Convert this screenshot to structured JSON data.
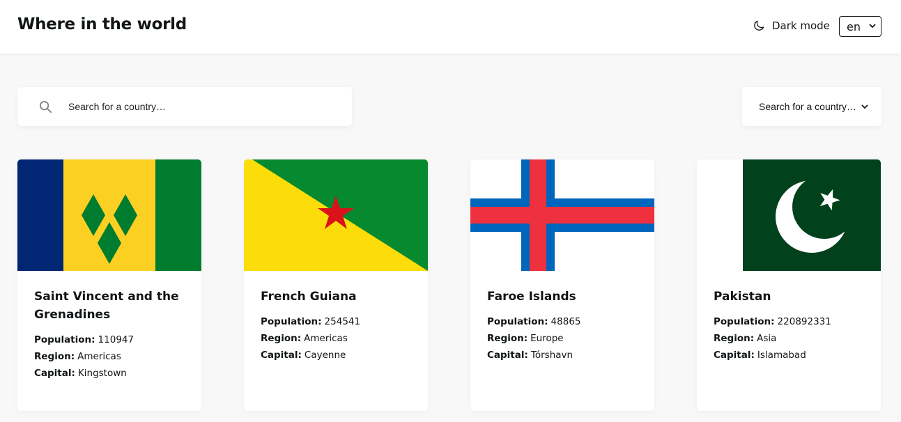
{
  "header": {
    "title": "Where in the world",
    "dark_mode_label": "Dark mode",
    "language": "en"
  },
  "search": {
    "placeholder": "Search for a country…"
  },
  "filter": {
    "label": "Search for a country…"
  },
  "labels": {
    "population": "Population:",
    "region": "Region:",
    "capital": "Capital:"
  },
  "countries": [
    {
      "name": "Saint Vincent and the Grenadines",
      "population": "110947",
      "region": "Americas",
      "capital": "Kingstown"
    },
    {
      "name": "French Guiana",
      "population": "254541",
      "region": "Americas",
      "capital": "Cayenne"
    },
    {
      "name": "Faroe Islands",
      "population": "48865",
      "region": "Europe",
      "capital": "Tórshavn"
    },
    {
      "name": "Pakistan",
      "population": "220892331",
      "region": "Asia",
      "capital": "Islamabad"
    }
  ],
  "colors": {
    "page_bg": "#f8f8f8",
    "element_bg": "#ffffff",
    "text": "#111517"
  }
}
